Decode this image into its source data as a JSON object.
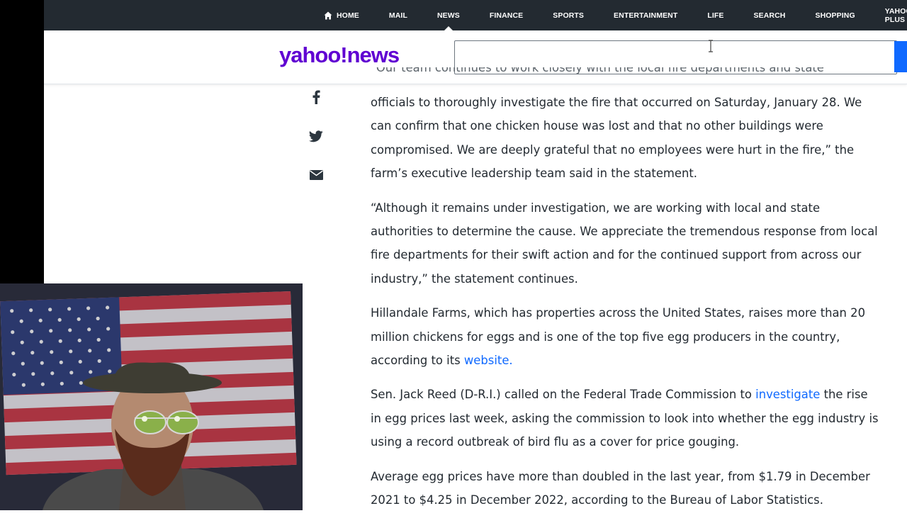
{
  "nav": {
    "items": [
      "HOME",
      "MAIL",
      "NEWS",
      "FINANCE",
      "SPORTS",
      "ENTERTAINMENT",
      "LIFE",
      "SEARCH",
      "SHOPPING",
      "YAHOO PLUS"
    ],
    "active": "NEWS"
  },
  "header": {
    "logo": "yahoo!news",
    "search_placeholder": ""
  },
  "share": {
    "icons": [
      "facebook-icon",
      "twitter-icon",
      "mail-icon"
    ]
  },
  "article": {
    "partial_line": "“Our team continues to work closely with the local fire departments and state",
    "p1": "officials to thoroughly investigate the fire that occurred on Saturday, January 28. We can confirm that one chicken house was lost and that no other buildings were compromised. We are deeply grateful that no employees were hurt in the fire,” the farm’s executive leadership team said in the statement.",
    "p2": "“Although it remains under investigation, we are working with local and state authorities to determine the cause. We appreciate the tremendous response from local fire departments for their swift action and for the continued support from across our industry,” the statement continues.",
    "p3_text": "Hillandale Farms, which has properties across the United States, raises more than 20 million chickens for eggs and is one of the top five egg producers in the country, according to its ",
    "p3_link": "website.",
    "p4_pre": "Sen. Jack Reed (D-R.I.) called on the Federal Trade Commission to ",
    "p4_link": "investigate",
    "p4_post": " the rise in egg prices last week, asking the commission to look into whether the egg industry is using a record outbreak of bird flu as a cover for price gouging.",
    "p5": "Average egg prices have more than doubled in the last year, from $1.79 in December 2021 to $4.25 in December 2022, according to the Bureau of Labor Statistics."
  },
  "colors": {
    "nav_bg": "#232a31",
    "brand": "#6001d2",
    "link": "#0f69ff"
  }
}
